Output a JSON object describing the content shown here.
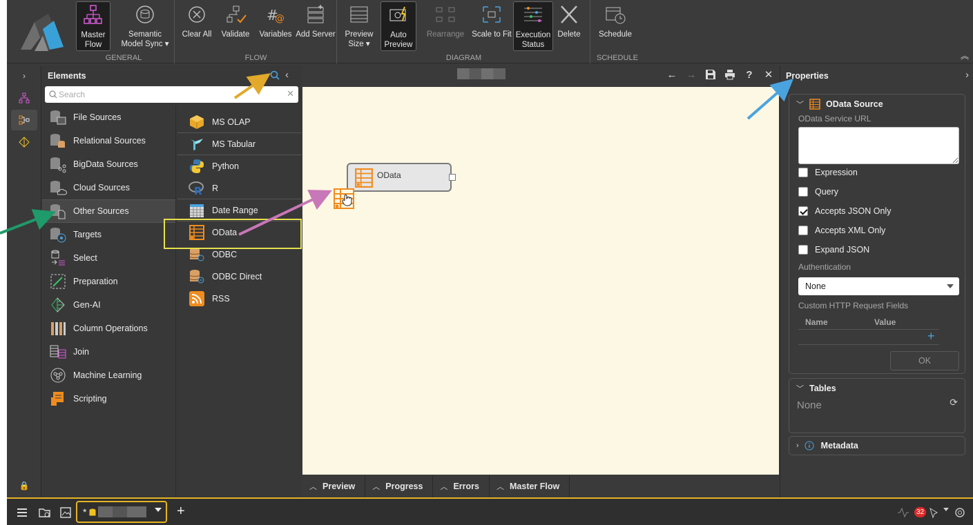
{
  "ribbon": {
    "groups": {
      "general": "GENERAL",
      "flow": "FLOW",
      "diagram": "DIAGRAM",
      "schedule": "SCHEDULE"
    },
    "buttons": {
      "master_flow": "Master Flow",
      "semantic_model_sync": "Semantic Model Sync ▾",
      "clear_all": "Clear All",
      "validate": "Validate",
      "variables": "Variables",
      "add_server": "Add Server",
      "preview_size": "Preview Size ▾",
      "auto_preview": "Auto Preview",
      "rearrange": "Rearrange",
      "scale_to_fit": "Scale to Fit",
      "execution_status": "Execution Status",
      "delete": "Delete",
      "schedule": "Schedule"
    }
  },
  "elements": {
    "title": "Elements",
    "search_placeholder": "Search",
    "categories": [
      {
        "label": "File Sources",
        "icon": "file-sources-icon"
      },
      {
        "label": "Relational Sources",
        "icon": "relational-sources-icon"
      },
      {
        "label": "BigData Sources",
        "icon": "bigdata-sources-icon"
      },
      {
        "label": "Cloud Sources",
        "icon": "cloud-sources-icon"
      },
      {
        "label": "Other Sources",
        "icon": "other-sources-icon",
        "selected": true
      },
      {
        "label": "Targets",
        "icon": "targets-icon"
      },
      {
        "label": "Select",
        "icon": "select-icon"
      },
      {
        "label": "Preparation",
        "icon": "preparation-icon"
      },
      {
        "label": "Gen-AI",
        "icon": "gen-ai-icon"
      },
      {
        "label": "Column Operations",
        "icon": "column-operations-icon"
      },
      {
        "label": "Join",
        "icon": "join-icon"
      },
      {
        "label": "Machine Learning",
        "icon": "machine-learning-icon"
      },
      {
        "label": "Scripting",
        "icon": "scripting-icon"
      }
    ],
    "items": [
      {
        "label": "MS OLAP",
        "icon": "ms-olap-icon"
      },
      {
        "label": "MS Tabular",
        "icon": "ms-tabular-icon"
      },
      {
        "label": "Python",
        "icon": "python-icon"
      },
      {
        "label": "R",
        "icon": "r-icon"
      },
      {
        "label": "Date Range",
        "icon": "date-range-icon"
      },
      {
        "label": "OData",
        "icon": "odata-icon"
      },
      {
        "label": "ODBC",
        "icon": "odbc-icon"
      },
      {
        "label": "ODBC Direct",
        "icon": "odbc-direct-icon"
      },
      {
        "label": "RSS",
        "icon": "rss-icon"
      }
    ]
  },
  "canvas": {
    "node_label": "OData",
    "bottom_tabs": [
      "Preview",
      "Progress",
      "Errors",
      "Master Flow"
    ]
  },
  "properties": {
    "title": "Properties",
    "odata_source": {
      "title": "OData Source",
      "service_url_label": "OData Service URL",
      "service_url_value": "",
      "checkboxes": [
        {
          "label": "Expression",
          "checked": false
        },
        {
          "label": "Query",
          "checked": false
        },
        {
          "label": "Accepts JSON Only",
          "checked": true
        },
        {
          "label": "Accepts XML Only",
          "checked": false
        },
        {
          "label": "Expand JSON",
          "checked": false
        }
      ],
      "authentication_label": "Authentication",
      "authentication_value": "None",
      "custom_fields_label": "Custom HTTP Request Fields",
      "table_headers": [
        "Name",
        "Value"
      ],
      "ok_label": "OK"
    },
    "tables": {
      "title": "Tables",
      "value": "None"
    },
    "metadata": {
      "title": "Metadata"
    }
  },
  "statusbar": {
    "doc_tab_prefix": "*",
    "add_label": "+",
    "notification_count": "32"
  },
  "colors": {
    "accent_orange": "#f08c1e",
    "highlight_yellow": "#e8e04c",
    "status_border": "#e6b422",
    "arrow_yellow": "#e3a92a",
    "arrow_blue": "#4aa3df",
    "arrow_green": "#1f9a6a",
    "arrow_pink": "#c877b8"
  }
}
